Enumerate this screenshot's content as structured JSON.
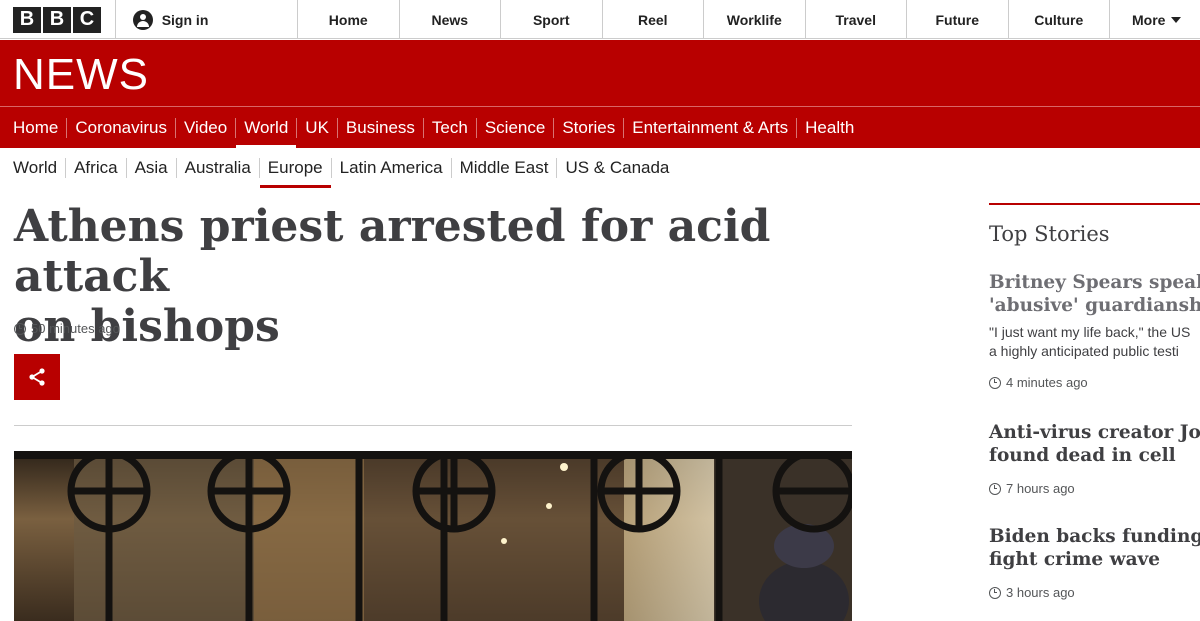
{
  "global_nav": {
    "logo_letters": [
      "B",
      "B",
      "C"
    ],
    "sign_in": "Sign in",
    "items": [
      "Home",
      "News",
      "Sport",
      "Reel",
      "Worklife",
      "Travel",
      "Future",
      "Culture"
    ],
    "more": "More"
  },
  "news_logo": "NEWS",
  "section_nav": {
    "items": [
      "Home",
      "Coronavirus",
      "Video",
      "World",
      "UK",
      "Business",
      "Tech",
      "Science",
      "Stories",
      "Entertainment & Arts",
      "Health"
    ],
    "active": "World"
  },
  "sub_nav": {
    "items": [
      "World",
      "Africa",
      "Asia",
      "Australia",
      "Europe",
      "Latin America",
      "Middle East",
      "US & Canada"
    ],
    "active": "Europe"
  },
  "article": {
    "headline_line1": "Athens priest arrested for acid attack",
    "headline_line2": "on bishops",
    "timestamp": "50 minutes ago",
    "share_icon": "share-icon"
  },
  "sidebar": {
    "title": "Top Stories",
    "stories": [
      {
        "title_line1": "Britney Spears speaks o",
        "title_line2": "'abusive' guardianship",
        "summary_line1": "\"I just want my life back,\" the US",
        "summary_line2": "a highly anticipated public testi",
        "time": "4 minutes ago"
      },
      {
        "title_line1": "Anti-virus creator John",
        "title_line2": "found dead in cell",
        "time": "7 hours ago"
      },
      {
        "title_line1": "Biden backs funding m",
        "title_line2": "fight crime wave",
        "time": "3 hours ago"
      }
    ]
  },
  "colors": {
    "brand_red": "#b80000",
    "headline_grey": "#3f3f42"
  }
}
